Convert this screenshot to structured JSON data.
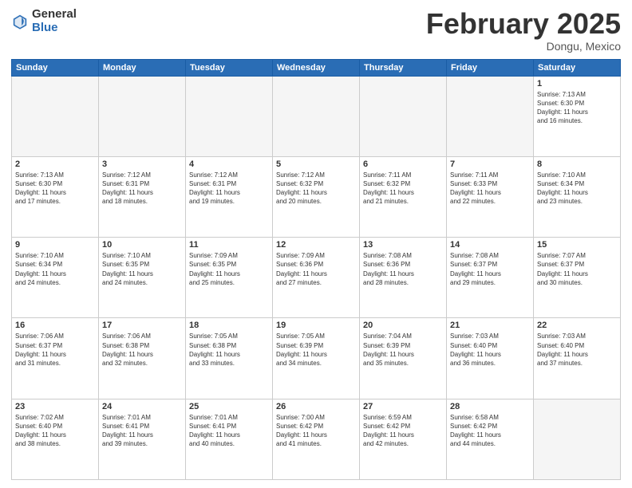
{
  "header": {
    "logo_general": "General",
    "logo_blue": "Blue",
    "month_title": "February 2025",
    "location": "Dongu, Mexico"
  },
  "weekdays": [
    "Sunday",
    "Monday",
    "Tuesday",
    "Wednesday",
    "Thursday",
    "Friday",
    "Saturday"
  ],
  "weeks": [
    [
      {
        "day": "",
        "info": ""
      },
      {
        "day": "",
        "info": ""
      },
      {
        "day": "",
        "info": ""
      },
      {
        "day": "",
        "info": ""
      },
      {
        "day": "",
        "info": ""
      },
      {
        "day": "",
        "info": ""
      },
      {
        "day": "1",
        "info": "Sunrise: 7:13 AM\nSunset: 6:30 PM\nDaylight: 11 hours\nand 16 minutes."
      }
    ],
    [
      {
        "day": "2",
        "info": "Sunrise: 7:13 AM\nSunset: 6:30 PM\nDaylight: 11 hours\nand 17 minutes."
      },
      {
        "day": "3",
        "info": "Sunrise: 7:12 AM\nSunset: 6:31 PM\nDaylight: 11 hours\nand 18 minutes."
      },
      {
        "day": "4",
        "info": "Sunrise: 7:12 AM\nSunset: 6:31 PM\nDaylight: 11 hours\nand 19 minutes."
      },
      {
        "day": "5",
        "info": "Sunrise: 7:12 AM\nSunset: 6:32 PM\nDaylight: 11 hours\nand 20 minutes."
      },
      {
        "day": "6",
        "info": "Sunrise: 7:11 AM\nSunset: 6:32 PM\nDaylight: 11 hours\nand 21 minutes."
      },
      {
        "day": "7",
        "info": "Sunrise: 7:11 AM\nSunset: 6:33 PM\nDaylight: 11 hours\nand 22 minutes."
      },
      {
        "day": "8",
        "info": "Sunrise: 7:10 AM\nSunset: 6:34 PM\nDaylight: 11 hours\nand 23 minutes."
      }
    ],
    [
      {
        "day": "9",
        "info": "Sunrise: 7:10 AM\nSunset: 6:34 PM\nDaylight: 11 hours\nand 24 minutes."
      },
      {
        "day": "10",
        "info": "Sunrise: 7:10 AM\nSunset: 6:35 PM\nDaylight: 11 hours\nand 24 minutes."
      },
      {
        "day": "11",
        "info": "Sunrise: 7:09 AM\nSunset: 6:35 PM\nDaylight: 11 hours\nand 25 minutes."
      },
      {
        "day": "12",
        "info": "Sunrise: 7:09 AM\nSunset: 6:36 PM\nDaylight: 11 hours\nand 27 minutes."
      },
      {
        "day": "13",
        "info": "Sunrise: 7:08 AM\nSunset: 6:36 PM\nDaylight: 11 hours\nand 28 minutes."
      },
      {
        "day": "14",
        "info": "Sunrise: 7:08 AM\nSunset: 6:37 PM\nDaylight: 11 hours\nand 29 minutes."
      },
      {
        "day": "15",
        "info": "Sunrise: 7:07 AM\nSunset: 6:37 PM\nDaylight: 11 hours\nand 30 minutes."
      }
    ],
    [
      {
        "day": "16",
        "info": "Sunrise: 7:06 AM\nSunset: 6:37 PM\nDaylight: 11 hours\nand 31 minutes."
      },
      {
        "day": "17",
        "info": "Sunrise: 7:06 AM\nSunset: 6:38 PM\nDaylight: 11 hours\nand 32 minutes."
      },
      {
        "day": "18",
        "info": "Sunrise: 7:05 AM\nSunset: 6:38 PM\nDaylight: 11 hours\nand 33 minutes."
      },
      {
        "day": "19",
        "info": "Sunrise: 7:05 AM\nSunset: 6:39 PM\nDaylight: 11 hours\nand 34 minutes."
      },
      {
        "day": "20",
        "info": "Sunrise: 7:04 AM\nSunset: 6:39 PM\nDaylight: 11 hours\nand 35 minutes."
      },
      {
        "day": "21",
        "info": "Sunrise: 7:03 AM\nSunset: 6:40 PM\nDaylight: 11 hours\nand 36 minutes."
      },
      {
        "day": "22",
        "info": "Sunrise: 7:03 AM\nSunset: 6:40 PM\nDaylight: 11 hours\nand 37 minutes."
      }
    ],
    [
      {
        "day": "23",
        "info": "Sunrise: 7:02 AM\nSunset: 6:40 PM\nDaylight: 11 hours\nand 38 minutes."
      },
      {
        "day": "24",
        "info": "Sunrise: 7:01 AM\nSunset: 6:41 PM\nDaylight: 11 hours\nand 39 minutes."
      },
      {
        "day": "25",
        "info": "Sunrise: 7:01 AM\nSunset: 6:41 PM\nDaylight: 11 hours\nand 40 minutes."
      },
      {
        "day": "26",
        "info": "Sunrise: 7:00 AM\nSunset: 6:42 PM\nDaylight: 11 hours\nand 41 minutes."
      },
      {
        "day": "27",
        "info": "Sunrise: 6:59 AM\nSunset: 6:42 PM\nDaylight: 11 hours\nand 42 minutes."
      },
      {
        "day": "28",
        "info": "Sunrise: 6:58 AM\nSunset: 6:42 PM\nDaylight: 11 hours\nand 44 minutes."
      },
      {
        "day": "",
        "info": ""
      }
    ]
  ]
}
